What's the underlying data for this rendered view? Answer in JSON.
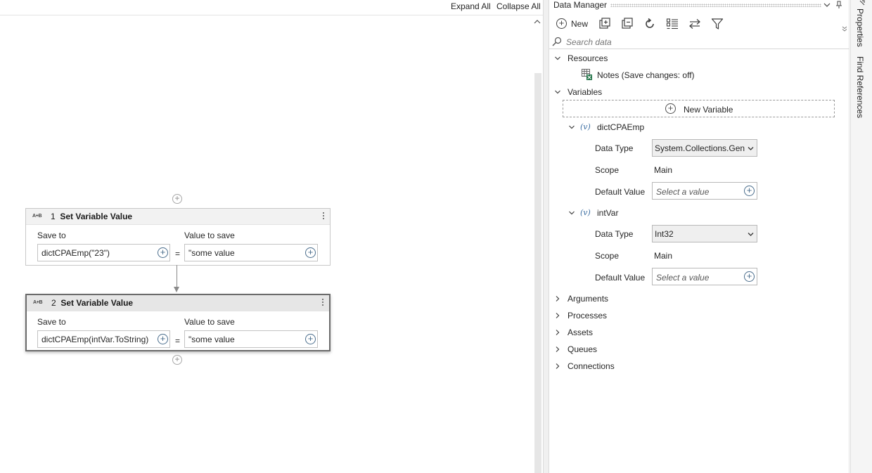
{
  "canvas": {
    "expand_all": "Expand All",
    "collapse_all": "Collapse All",
    "activities": [
      {
        "number": "1",
        "title": "Set Variable Value",
        "icon": "A+B",
        "save_to_label": "Save to",
        "value_label": "Value to save",
        "save_to_value": "dictCPAEmp(\"23\")",
        "value_to_save": "\"some value",
        "equals": "="
      },
      {
        "number": "2",
        "title": "Set Variable Value",
        "icon": "A+B",
        "save_to_label": "Save to",
        "value_label": "Value to save",
        "save_to_value": "dictCPAEmp(intVar.ToString)",
        "value_to_save": "\"some value",
        "equals": "="
      }
    ]
  },
  "data_manager": {
    "title": "Data Manager",
    "toolbar": {
      "new_label": "New"
    },
    "search": {
      "placeholder": "Search data"
    },
    "resources": {
      "label": "Resources",
      "items": [
        {
          "label": "Notes (Save changes: off)"
        }
      ]
    },
    "variables": {
      "label": "Variables",
      "new_variable_label": "New Variable",
      "labels": {
        "data_type": "Data Type",
        "scope": "Scope",
        "default_value": "Default Value"
      },
      "items": [
        {
          "name": "dictCPAEmp",
          "icon_glyph": "(v)",
          "data_type": "System.Collections.Generic",
          "scope": "Main",
          "default_placeholder": "Select a value"
        },
        {
          "name": "intVar",
          "icon_glyph": "(v)",
          "data_type": "Int32",
          "scope": "Main",
          "default_placeholder": "Select a value"
        }
      ]
    },
    "sections": [
      "Arguments",
      "Processes",
      "Assets",
      "Queues",
      "Connections"
    ]
  },
  "right_rail": {
    "tabs": [
      "Properties",
      "Find References"
    ]
  },
  "colors": {
    "accent_plus": "#4a6d8c",
    "variable_icon": "#3d6fa3",
    "excel_green": "#1e7145"
  }
}
